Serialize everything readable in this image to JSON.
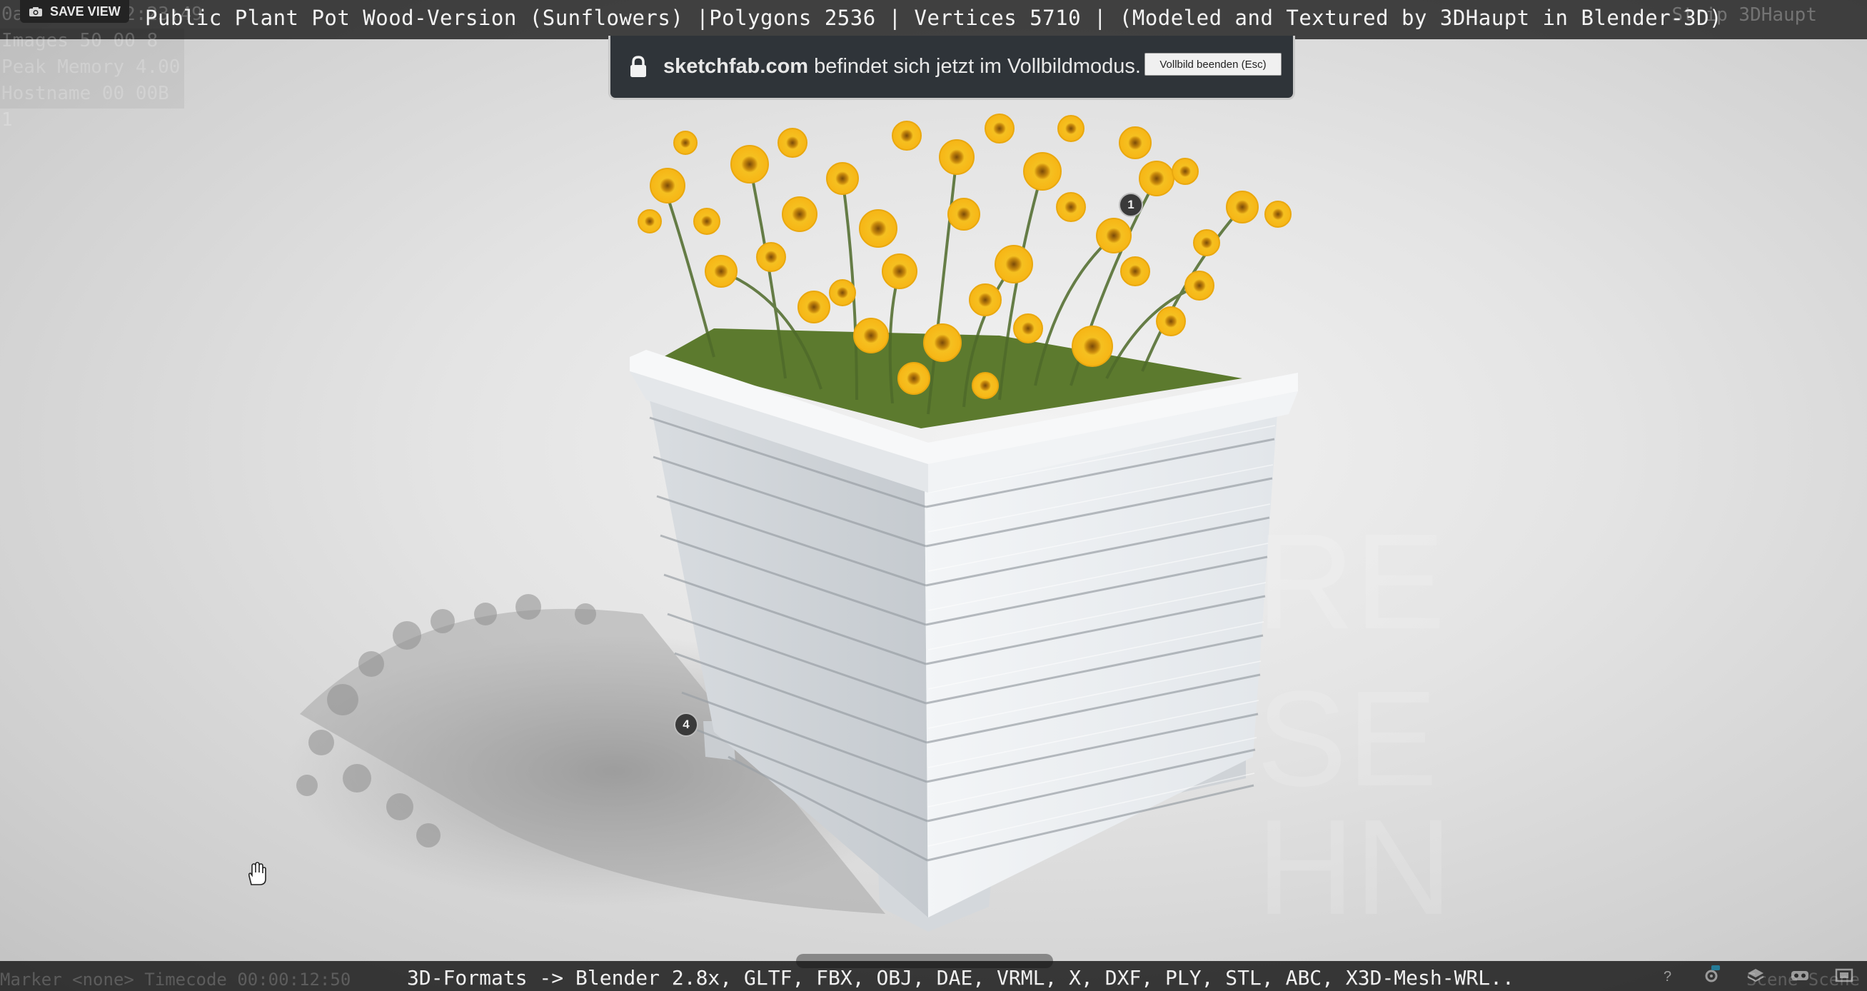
{
  "window": {
    "title": "Public Plant Pot Wood-Version (Sunflowers) |Polygons 2536 | Vertices 5710 | (Modeled and Textured by 3DHaupt in Blender-3D)"
  },
  "toolbar": {
    "save_view_label": "SAVE VIEW"
  },
  "debug": {
    "lines": [
      "0ae-21-17 12:23:49",
      "Images 50 00 8",
      "Peak Memory 4.00",
      "Hostname 00 00B",
      "1"
    ],
    "right_label": "Strip 3DHaupt"
  },
  "fullscreen_notice": {
    "domain": "sketchfab.com",
    "message": "befindet sich jetzt im Vollbildmodus.",
    "exit_button": "Vollbild beenden (Esc)"
  },
  "annotations": [
    "1",
    "4"
  ],
  "footer": {
    "formats": "3D-Formats -> Blender 2.8x, GLTF, FBX, OBJ, DAE, VRML, X, DXF, PLY, STL, ABC, X3D-Mesh-WRL..",
    "ghost_left": "Marker <none>   Timecode 00:00:12:50",
    "ghost_right": "Scene Scene"
  },
  "icons": [
    "camera-icon",
    "lock-icon",
    "help-icon",
    "settings-icon",
    "layers-icon",
    "vr-icon",
    "fullscreen-icon",
    "hand-cursor-icon"
  ],
  "colors": {
    "bar_bg": "#141414",
    "notice_bg": "#2f3439",
    "flower_yellow": "#f2b81a",
    "pot_white": "#e9ecef"
  }
}
